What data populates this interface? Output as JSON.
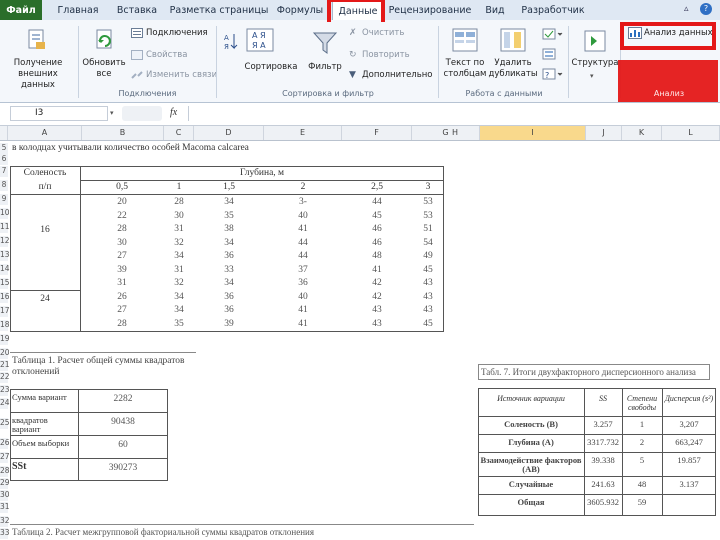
{
  "tabs": [
    "Файл",
    "Главная",
    "Вставка",
    "Разметка страницы",
    "Формулы",
    "Данные",
    "Рецензирование",
    "Вид",
    "Разработчик"
  ],
  "ribbon": {
    "get_external": "Получение\nвнешних данных",
    "refresh_all": "Обновить\nвсе",
    "connections": "Подключения",
    "properties": "Свойства",
    "edit_links": "Изменить связи",
    "group_connections": "Подключения",
    "sort": "Сортировка",
    "filter": "Фильтр",
    "clear": "Очистить",
    "reapply": "Повторить",
    "advanced": "Дополнительно",
    "group_sort": "Сортировка и фильтр",
    "text_to_columns": "Текст по\nстолбцам",
    "remove_duplicates": "Удалить\nдубликаты",
    "group_data_tools": "Работа с данными",
    "outline": "Структура",
    "data_analysis": "Анализ данных",
    "group_analysis": "Анализ"
  },
  "formula_bar": {
    "name_box": "I3",
    "fx": "fx"
  },
  "columns": [
    "A",
    "B",
    "C",
    "D",
    "E",
    "F",
    "G",
    "H",
    "I",
    "J",
    "K",
    "L"
  ],
  "rows": [
    "5",
    "6",
    "7",
    "8",
    "9",
    "10",
    "11",
    "12",
    "13",
    "14",
    "15",
    "16",
    "17",
    "18",
    "19",
    "20",
    "21",
    "22",
    "23",
    "24",
    "25",
    "26",
    "27",
    "28",
    "29",
    "30",
    "31",
    "32",
    "33"
  ],
  "sheet": {
    "title": "в колодцах учитывали количество особей Macoma calcarea",
    "hdr_salinity": "Соленость",
    "hdr_depth": "Глубина, м",
    "hdr_pp": "п/п",
    "depths": [
      "0,5",
      "1",
      "1,5",
      "2",
      "2,5",
      "3"
    ],
    "sal1": "16",
    "sal2": "24",
    "data": [
      [
        "20",
        "28",
        "34",
        "3-",
        "44",
        "53"
      ],
      [
        "22",
        "30",
        "35",
        "40",
        "45",
        "53"
      ],
      [
        "28",
        "31",
        "38",
        "41",
        "46",
        "51"
      ],
      [
        "30",
        "32",
        "34",
        "44",
        "46",
        "54"
      ],
      [
        "27",
        "34",
        "36",
        "44",
        "48",
        "49"
      ],
      [
        "39",
        "31",
        "33",
        "37",
        "41",
        "45"
      ],
      [
        "31",
        "32",
        "34",
        "36",
        "42",
        "43"
      ],
      [
        "26",
        "34",
        "36",
        "40",
        "42",
        "43"
      ],
      [
        "27",
        "34",
        "36",
        "41",
        "43",
        "43"
      ],
      [
        "28",
        "35",
        "39",
        "41",
        "43",
        "45"
      ]
    ],
    "t1_title": "Таблица 1. Расчет общей суммы квадратов отклонений",
    "t1_rows": [
      [
        "Сумма вариант",
        "2282"
      ],
      [
        "квадратов вариант",
        "90438"
      ],
      [
        "Объем выборки",
        "60"
      ],
      [
        "SSt",
        "390273"
      ]
    ],
    "t2_title": "Табл. 7. Итоги двухфакторного дисперсионного анализа",
    "t2_header": [
      "Источник вариации",
      "SS",
      "Степени свободы",
      "Дисперсия (s²)"
    ],
    "t2_rows": [
      [
        "Соленость (B)",
        "3.257",
        "1",
        "3,207"
      ],
      [
        "Глубина (A)",
        "3317.732",
        "2",
        "663,247"
      ],
      [
        "Взаимодействие факторов (AB)",
        "39.338",
        "5",
        "19.857"
      ],
      [
        "Случайные",
        "241.63",
        "48",
        "3.137"
      ],
      [
        "Общая",
        "3605.932",
        "59",
        ""
      ]
    ],
    "t3_title": "Таблица 2. Расчет межгрупповой факториальной суммы квадратов отклонения"
  }
}
